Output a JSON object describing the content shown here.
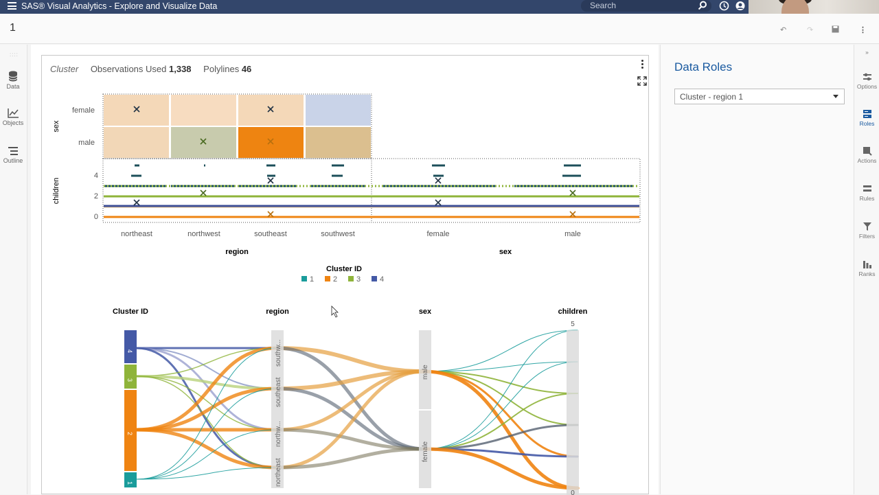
{
  "app": {
    "title": "SAS® Visual Analytics - Explore and Visualize Data",
    "search_placeholder": "Search",
    "page_label": "1"
  },
  "left_nav": [
    {
      "label": "Data",
      "icon": "database-icon"
    },
    {
      "label": "Objects",
      "icon": "chart-icon"
    },
    {
      "label": "Outline",
      "icon": "outline-icon"
    }
  ],
  "report": {
    "title": "Cluster",
    "obs_label": "Observations Used",
    "obs_value": "1,338",
    "poly_label": "Polylines",
    "poly_value": "46"
  },
  "matrix": {
    "row_var_top": "sex",
    "row_var_bottom": "children",
    "sex_levels": [
      "female",
      "male"
    ],
    "children_ticks": [
      "4",
      "2",
      "0"
    ],
    "region_levels": [
      "northeast",
      "northwest",
      "southeast",
      "southwest"
    ],
    "sex_levels_x": [
      "female",
      "male"
    ],
    "xlabel_region": "region",
    "xlabel_sex": "sex"
  },
  "legend": {
    "title": "Cluster ID",
    "items": [
      {
        "label": "1",
        "color": "#1a9c9b"
      },
      {
        "label": "2",
        "color": "#ef8412"
      },
      {
        "label": "3",
        "color": "#8fb43a"
      },
      {
        "label": "4",
        "color": "#4459a6"
      }
    ]
  },
  "parallel": {
    "axes": [
      "Cluster ID",
      "region",
      "sex",
      "children"
    ],
    "cluster_ticks": [
      "4",
      "3",
      "2",
      "1"
    ],
    "region_bars": [
      "southw...",
      "southeast",
      "northw...",
      "northeast"
    ],
    "sex_bars": [
      "male",
      "female"
    ],
    "children_max": "5",
    "children_min": "0"
  },
  "right_panel": {
    "title": "Data Roles",
    "select_value": "Cluster - region 1"
  },
  "right_bar": [
    {
      "label": "Options",
      "icon": "options-icon"
    },
    {
      "label": "Roles",
      "icon": "roles-icon",
      "active": true
    },
    {
      "label": "Actions",
      "icon": "actions-icon"
    },
    {
      "label": "Rules",
      "icon": "rules-icon"
    },
    {
      "label": "Filters",
      "icon": "filter-icon"
    },
    {
      "label": "Ranks",
      "icon": "ranks-icon"
    }
  ]
}
